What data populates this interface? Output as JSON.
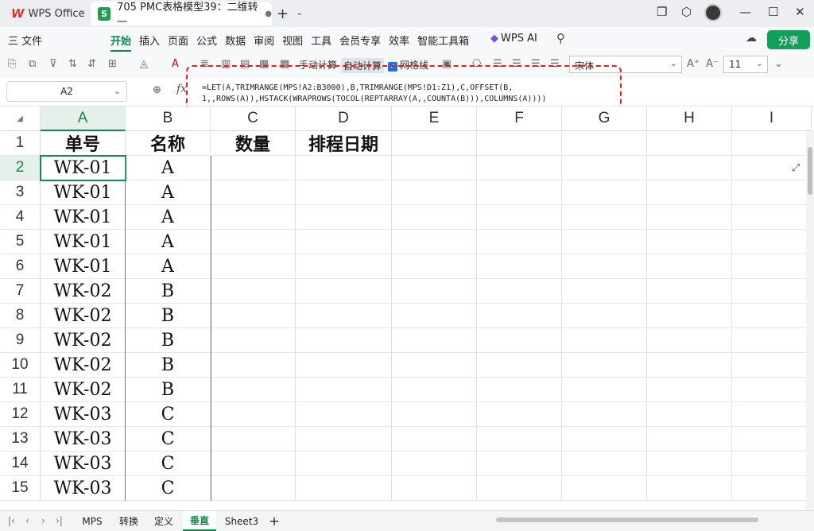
{
  "titlebar": {
    "app_tab": "WPS Office",
    "app_logo": "W",
    "doc_icon": "S",
    "doc_tab": "705 PMC表格模型39：二维转一",
    "new_tab": "+",
    "new_tab_dropdown": "⌄",
    "icons": [
      "window-restore-icon",
      "cube-icon",
      "avatar",
      "minimize-icon",
      "maximize-icon",
      "close-icon"
    ]
  },
  "menubar": {
    "file": "三 文件",
    "items": [
      "开始",
      "插入",
      "页面",
      "公式",
      "数据",
      "审阅",
      "视图",
      "工具",
      "会员专享",
      "效率",
      "智能工具箱"
    ],
    "active": "开始",
    "wps_ai": "WPS AI",
    "share": "分享"
  },
  "toolbar": {
    "manual_calc": "手动计算",
    "auto_calc": "自动计算",
    "gridlines": "网格线",
    "font_name": "宋体",
    "font_size": "11"
  },
  "formula_bar": {
    "name_box": "A2",
    "fx": "fx",
    "formula": "=LET(A,TRIMRANGE(MPS!A2:B3000),B,TRIMRANGE(MPS!D1:Z1),C,OFFSET(B,\n1,,ROWS(A)),HSTACK(WRAPROWS(TOCOL(REPTARRAY(A,,COUNTA(B))),COLUMNS(A))))"
  },
  "grid": {
    "columns": [
      "A",
      "B",
      "C",
      "D",
      "E",
      "F",
      "G",
      "H",
      "I"
    ],
    "selected_column": "A",
    "rows": [
      "1",
      "2",
      "3",
      "4",
      "5",
      "6",
      "7",
      "8",
      "9",
      "10",
      "11",
      "12",
      "13",
      "14",
      "15"
    ],
    "selected_row": "2",
    "header_row": [
      "单号",
      "名称",
      "数量",
      "排程日期"
    ],
    "data": [
      [
        "WK-01",
        "A"
      ],
      [
        "WK-01",
        "A"
      ],
      [
        "WK-01",
        "A"
      ],
      [
        "WK-01",
        "A"
      ],
      [
        "WK-01",
        "A"
      ],
      [
        "WK-02",
        "B"
      ],
      [
        "WK-02",
        "B"
      ],
      [
        "WK-02",
        "B"
      ],
      [
        "WK-02",
        "B"
      ],
      [
        "WK-02",
        "B"
      ],
      [
        "WK-03",
        "C"
      ],
      [
        "WK-03",
        "C"
      ],
      [
        "WK-03",
        "C"
      ],
      [
        "WK-03",
        "C"
      ]
    ]
  },
  "sheets": {
    "tabs": [
      "MPS",
      "转换",
      "定义",
      "垂直",
      "Sheet3"
    ],
    "active": "垂直",
    "add": "+"
  },
  "colors": {
    "accent": "#0f8a4f",
    "annotation": "#e02020"
  }
}
